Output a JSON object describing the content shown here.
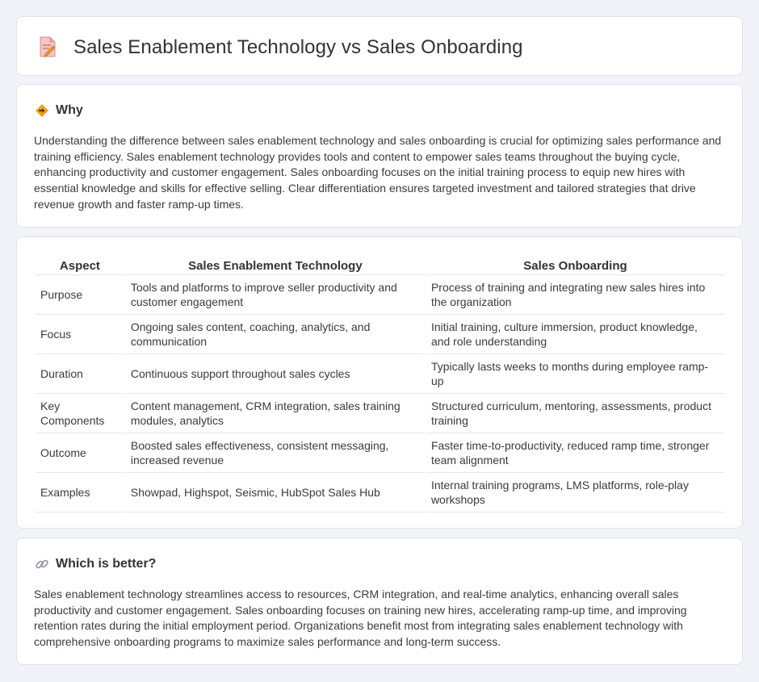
{
  "header": {
    "title": "Sales Enablement Technology vs Sales Onboarding",
    "icon": "document-edit-icon"
  },
  "why": {
    "heading": "Why",
    "icon": "diamond-warning-icon",
    "text": "Understanding the difference between sales enablement technology and sales onboarding is crucial for optimizing sales performance and training efficiency. Sales enablement technology provides tools and content to empower sales teams throughout the buying cycle, enhancing productivity and customer engagement. Sales onboarding focuses on the initial training process to equip new hires with essential knowledge and skills for effective selling. Clear differentiation ensures targeted investment and tailored strategies that drive revenue growth and faster ramp-up times."
  },
  "comparison": {
    "headers": [
      "Aspect",
      "Sales Enablement Technology",
      "Sales Onboarding"
    ],
    "rows": [
      [
        "Purpose",
        "Tools and platforms to improve seller productivity and customer engagement",
        "Process of training and integrating new sales hires into the organization"
      ],
      [
        "Focus",
        "Ongoing sales content, coaching, analytics, and communication",
        "Initial training, culture immersion, product knowledge, and role understanding"
      ],
      [
        "Duration",
        "Continuous support throughout sales cycles",
        "Typically lasts weeks to months during employee ramp-up"
      ],
      [
        "Key Components",
        "Content management, CRM integration, sales training modules, analytics",
        "Structured curriculum, mentoring, assessments, product training"
      ],
      [
        "Outcome",
        "Boosted sales effectiveness, consistent messaging, increased revenue",
        "Faster time-to-productivity, reduced ramp time, stronger team alignment"
      ],
      [
        "Examples",
        "Showpad, Highspot, Seismic, HubSpot Sales Hub",
        "Internal training programs, LMS platforms, role-play workshops"
      ]
    ]
  },
  "better": {
    "heading": "Which is better?",
    "icon": "link-icon",
    "text": "Sales enablement technology streamlines access to resources, CRM integration, and real-time analytics, enhancing overall sales productivity and customer engagement. Sales onboarding focuses on training new hires, accelerating ramp-up time, and improving retention rates during the initial employment period. Organizations benefit most from integrating sales enablement technology with comprehensive onboarding programs to maximize sales performance and long-term success."
  },
  "colors": {
    "page_background": "#f1f3f8",
    "card_background": "#ffffff",
    "accent_orange": "#f0a020",
    "icon_pink": "#e98b8b"
  }
}
